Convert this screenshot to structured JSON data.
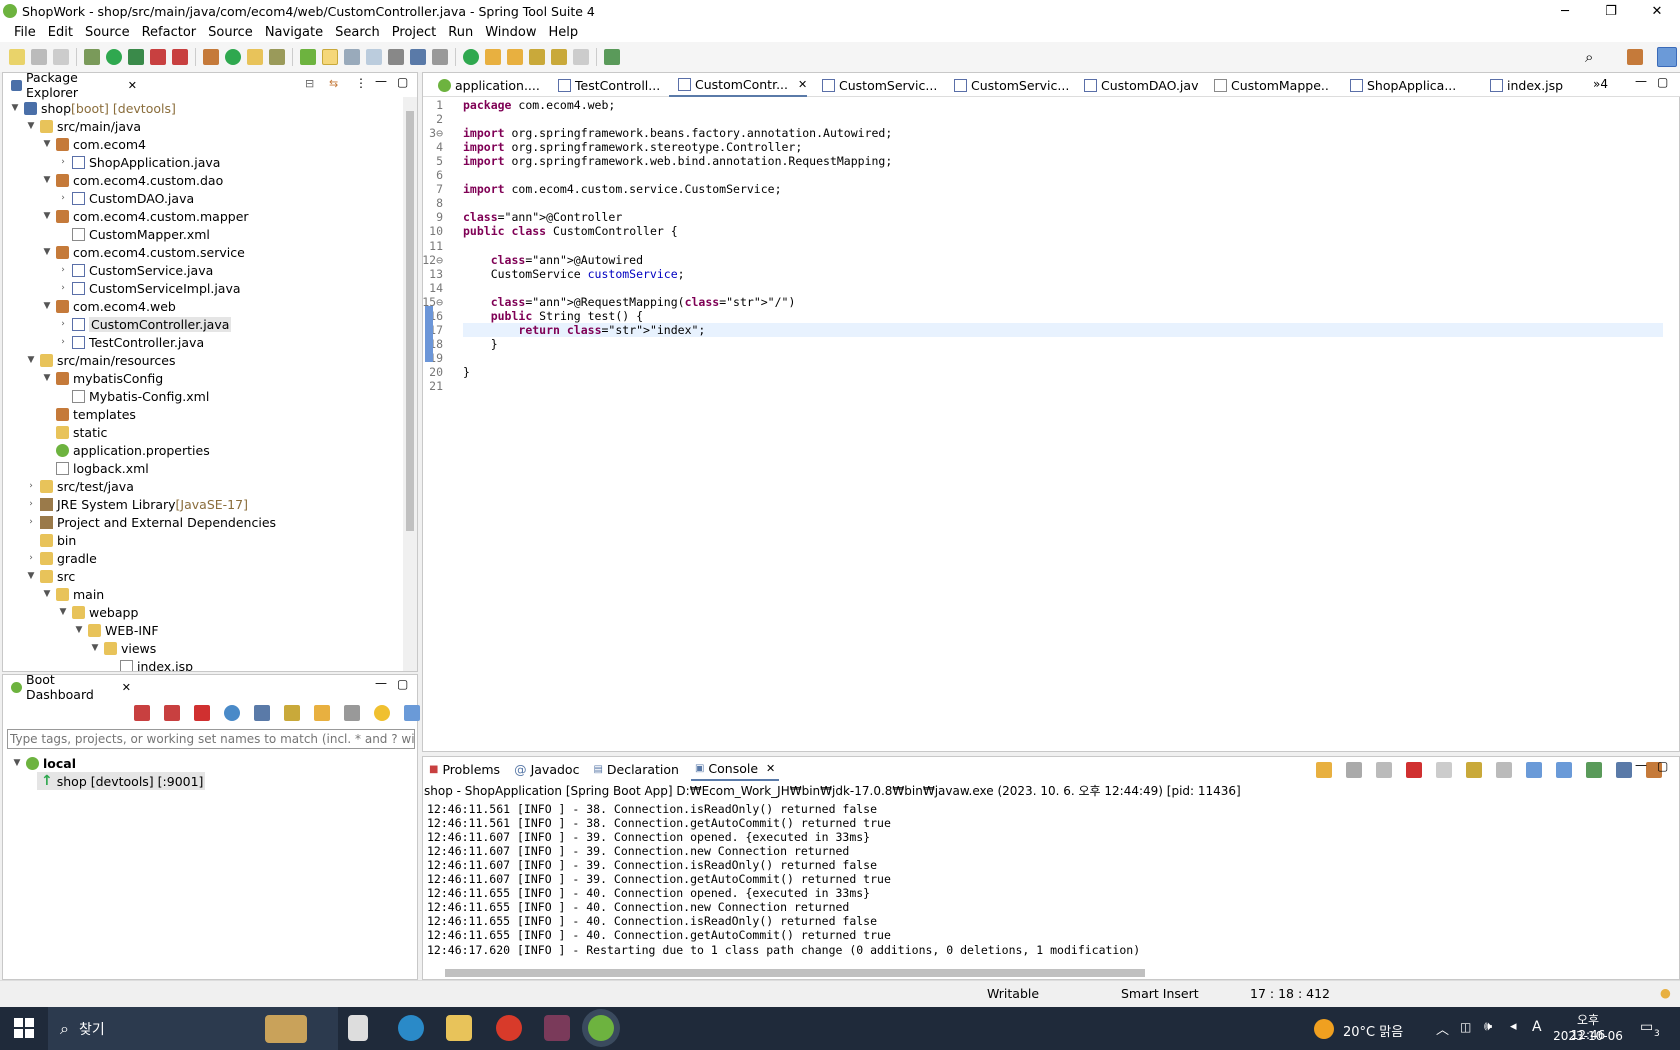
{
  "window": {
    "title": "ShopWork - shop/src/main/java/com/ecom4/web/CustomController.java - Spring Tool Suite 4",
    "minimize": "─",
    "maximize": "❐",
    "close": "✕"
  },
  "menu": [
    "File",
    "Edit",
    "Source",
    "Refactor",
    "Source",
    "Navigate",
    "Search",
    "Project",
    "Run",
    "Window",
    "Help"
  ],
  "package_explorer": {
    "title": "Package Explorer",
    "tree": [
      {
        "label": "shop",
        "deco": " [boot] [devtools]",
        "indent": 0,
        "twisty": "▼",
        "icon": "proj"
      },
      {
        "label": "src/main/java",
        "indent": 1,
        "twisty": "▼",
        "icon": "folder"
      },
      {
        "label": "com.ecom4",
        "indent": 2,
        "twisty": "▼",
        "icon": "pkg"
      },
      {
        "label": "ShopApplication.java",
        "indent": 3,
        "twisty": "›",
        "icon": "java"
      },
      {
        "label": "com.ecom4.custom.dao",
        "indent": 2,
        "twisty": "▼",
        "icon": "pkg"
      },
      {
        "label": "CustomDAO.java",
        "indent": 3,
        "twisty": "›",
        "icon": "java"
      },
      {
        "label": "com.ecom4.custom.mapper",
        "indent": 2,
        "twisty": "▼",
        "icon": "pkg"
      },
      {
        "label": "CustomMapper.xml",
        "indent": 3,
        "twisty": "",
        "icon": "xml"
      },
      {
        "label": "com.ecom4.custom.service",
        "indent": 2,
        "twisty": "▼",
        "icon": "pkg"
      },
      {
        "label": "CustomService.java",
        "indent": 3,
        "twisty": "›",
        "icon": "java"
      },
      {
        "label": "CustomServiceImpl.java",
        "indent": 3,
        "twisty": "›",
        "icon": "java"
      },
      {
        "label": "com.ecom4.web",
        "indent": 2,
        "twisty": "▼",
        "icon": "pkg"
      },
      {
        "label": "CustomController.java",
        "indent": 3,
        "twisty": "›",
        "icon": "java",
        "selected": true
      },
      {
        "label": "TestController.java",
        "indent": 3,
        "twisty": "›",
        "icon": "java"
      },
      {
        "label": "src/main/resources",
        "indent": 1,
        "twisty": "▼",
        "icon": "folder"
      },
      {
        "label": "mybatisConfig",
        "indent": 2,
        "twisty": "▼",
        "icon": "pkg"
      },
      {
        "label": "Mybatis-Config.xml",
        "indent": 3,
        "twisty": "",
        "icon": "xml"
      },
      {
        "label": "templates",
        "indent": 2,
        "twisty": "",
        "icon": "pkg"
      },
      {
        "label": "static",
        "indent": 2,
        "twisty": "",
        "icon": "folder"
      },
      {
        "label": "application.properties",
        "indent": 2,
        "twisty": "",
        "icon": "spring"
      },
      {
        "label": "logback.xml",
        "indent": 2,
        "twisty": "",
        "icon": "xml"
      },
      {
        "label": "src/test/java",
        "indent": 1,
        "twisty": "›",
        "icon": "folder"
      },
      {
        "label": "JRE System Library",
        "deco": " [JavaSE-17]",
        "indent": 1,
        "twisty": "›",
        "icon": "lib"
      },
      {
        "label": "Project and External Dependencies",
        "indent": 1,
        "twisty": "›",
        "icon": "lib"
      },
      {
        "label": "bin",
        "indent": 1,
        "twisty": "",
        "icon": "folder"
      },
      {
        "label": "gradle",
        "indent": 1,
        "twisty": "›",
        "icon": "folder"
      },
      {
        "label": "src",
        "indent": 1,
        "twisty": "▼",
        "icon": "folder"
      },
      {
        "label": "main",
        "indent": 2,
        "twisty": "▼",
        "icon": "folder"
      },
      {
        "label": "webapp",
        "indent": 3,
        "twisty": "▼",
        "icon": "folder"
      },
      {
        "label": "WEB-INF",
        "indent": 4,
        "twisty": "▼",
        "icon": "folder"
      },
      {
        "label": "views",
        "indent": 5,
        "twisty": "▼",
        "icon": "folder"
      },
      {
        "label": "index.jsp",
        "indent": 6,
        "twisty": "",
        "icon": "xml"
      }
    ]
  },
  "boot_dashboard": {
    "title": "Boot Dashboard",
    "filter_placeholder": "Type tags, projects, or working set names to match (incl. * and ? wildcards)",
    "local": "local",
    "app": "shop [devtools] [:9001]"
  },
  "editor_tabs": [
    {
      "label": "application....",
      "active": false
    },
    {
      "label": "TestControll...",
      "active": false
    },
    {
      "label": "CustomContr...",
      "active": true
    },
    {
      "label": "CustomServic...",
      "active": false
    },
    {
      "label": "CustomServic...",
      "active": false
    },
    {
      "label": "CustomDAO.java",
      "active": false
    },
    {
      "label": "CustomMappe...",
      "active": false
    },
    {
      "label": "ShopApplica...",
      "active": false
    },
    {
      "label": "index.jsp",
      "active": false
    }
  ],
  "editor_overflow": "»4",
  "code": [
    {
      "n": "1",
      "t": "package com.ecom4.web;"
    },
    {
      "n": "2",
      "t": ""
    },
    {
      "n": "3⊖",
      "t": "import org.springframework.beans.factory.annotation.Autowired;"
    },
    {
      "n": "4",
      "t": "import org.springframework.stereotype.Controller;"
    },
    {
      "n": "5",
      "t": "import org.springframework.web.bind.annotation.RequestMapping;"
    },
    {
      "n": "6",
      "t": ""
    },
    {
      "n": "7",
      "t": "import com.ecom4.custom.service.CustomService;"
    },
    {
      "n": "8",
      "t": ""
    },
    {
      "n": "9",
      "t": "@Controller"
    },
    {
      "n": "10",
      "t": "public class CustomController {"
    },
    {
      "n": "11",
      "t": ""
    },
    {
      "n": "12⊖",
      "t": "    @Autowired"
    },
    {
      "n": "13",
      "t": "    CustomService customService;"
    },
    {
      "n": "14",
      "t": ""
    },
    {
      "n": "15⊖",
      "t": "    @RequestMapping(\"/\")"
    },
    {
      "n": "16",
      "t": "    public String test() {"
    },
    {
      "n": "17",
      "t": "        return \"index\";"
    },
    {
      "n": "18",
      "t": "    }"
    },
    {
      "n": "19",
      "t": ""
    },
    {
      "n": "20",
      "t": "}"
    },
    {
      "n": "21",
      "t": ""
    }
  ],
  "bottom_tabs": [
    "Problems",
    "Javadoc",
    "Declaration",
    "Console"
  ],
  "console": {
    "header": "shop - ShopApplication [Spring Boot App] D:₩Ecom_Work_JH₩bin₩jdk-17.0.8₩bin₩javaw.exe  (2023. 10. 6. 오후 12:44:49) [pid: 11436]",
    "lines": [
      "12:46:11.561 [INFO ] - 38. Connection.isReadOnly() returned false",
      "12:46:11.561 [INFO ] - 38. Connection.getAutoCommit() returned true",
      "12:46:11.607 [INFO ] - 39. Connection opened. {executed in 33ms}",
      "12:46:11.607 [INFO ] - 39. Connection.new Connection returned",
      "12:46:11.607 [INFO ] - 39. Connection.isReadOnly() returned false",
      "12:46:11.607 [INFO ] - 39. Connection.getAutoCommit() returned true",
      "12:46:11.655 [INFO ] - 40. Connection opened. {executed in 33ms}",
      "12:46:11.655 [INFO ] - 40. Connection.new Connection returned",
      "12:46:11.655 [INFO ] - 40. Connection.isReadOnly() returned false",
      "12:46:11.655 [INFO ] - 40. Connection.getAutoCommit() returned true",
      "12:46:17.620 [INFO ] - Restarting due to 1 class path change (0 additions, 0 deletions, 1 modification)"
    ]
  },
  "status": {
    "writable": "Writable",
    "insert": "Smart Insert",
    "position": "17 : 18 : 412"
  },
  "taskbar": {
    "search": "찾기",
    "weather": "20°C 맑음",
    "time": "오후 12:46",
    "date": "2023-10-06",
    "ime": "A",
    "notif": "3"
  }
}
